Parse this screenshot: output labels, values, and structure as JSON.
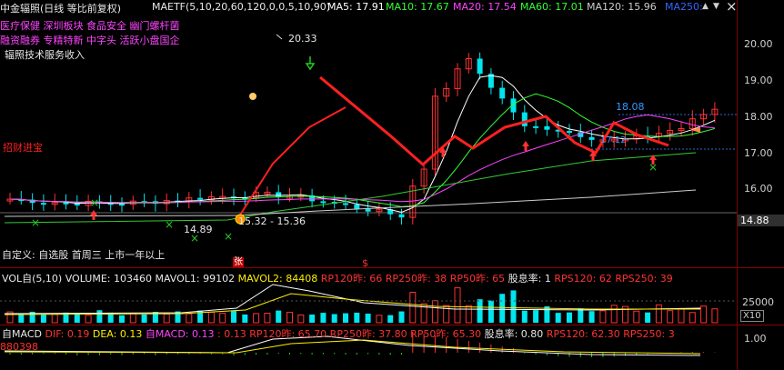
{
  "window": {
    "title": "中金辐照(日线 等比前复权)",
    "close_icon": "×",
    "up_icon": "▲",
    "down_icon": "▼"
  },
  "ma_bar": {
    "formula": "MAETF(5,10,20,60,120,0,0,5,10,90)",
    "items": [
      {
        "label": "MA5: 17.91",
        "color": "#ffffff"
      },
      {
        "label": "MA10: 17.67",
        "color": "#33ff33"
      },
      {
        "label": "MA20: 17.54",
        "color": "#ff44ff"
      },
      {
        "label": "MA60: 17.01",
        "color": "#33ff33"
      },
      {
        "label": "MA120: 15.96",
        "color": "#cccccc"
      },
      {
        "label": "MA250: ",
        "color": "#3366ff"
      }
    ]
  },
  "concepts": {
    "line1": [
      "医疗保健",
      "深圳板块",
      "食品安全",
      "幽门螺杆菌"
    ],
    "line2": [
      "融资融券",
      "专精特新",
      "中字头",
      "活跃小盘国企"
    ],
    "line3": "辐照技术服务收入"
  },
  "annotations": {
    "high_price": "20.33",
    "low_price": "14.89",
    "range_label": "15.32 - 15.36",
    "level_1808": "18.08",
    "level_1712": "17.12",
    "last_price": "14.88",
    "brand_tag": "招财进宝",
    "zhang_mark": "张",
    "dollar_mark": "$"
  },
  "price_axis": [
    "20.00",
    "19.00",
    "18.00",
    "17.00",
    "16.00"
  ],
  "custom_bar": "自定义: 自选股 首周三 上市一年以上",
  "vol_pane": {
    "title": "VOL自(5,10)",
    "volume": "VOLUME: 103460",
    "mavol1": "MAVOL1: 99102",
    "mavol2": "MAVOL2: 84408",
    "rp120": "RP120昨: 66",
    "rp250": "RP250昨: 38",
    "rp50": "RP50昨: 65",
    "dividend": "股息率: 1",
    "rps120": "RPS120: 62",
    "rps250": "RPS250: 39",
    "rps_tail": "RPS",
    "axis_value": "25000",
    "axis_unit": "X10"
  },
  "macd_pane": {
    "title": "自MACD",
    "dif": "DIF: 0.19",
    "dea": "DEA: 0.13",
    "macd": "自MACD: 0.13",
    "v2": ": 0.13",
    "rp120": "RP120昨: 65.70",
    "rp250": "RP250昨: 37.80",
    "rp50": "RP50昨: 65.30",
    "dividend": "股息率: 0.80",
    "rps120": "RPS120: 62.30",
    "rps250": "RPS250: 3",
    "left_value": "880398",
    "axis_value": "1.00"
  },
  "colors": {
    "up": "#ff3232",
    "down": "#00e5ee",
    "ma5": "#ffffff",
    "ma10": "#33ff33",
    "ma20": "#ff44ff",
    "ma60": "#33cc33",
    "ma120": "#cccccc",
    "accent": "#ff2020",
    "marker_green": "#22cc22"
  }
}
